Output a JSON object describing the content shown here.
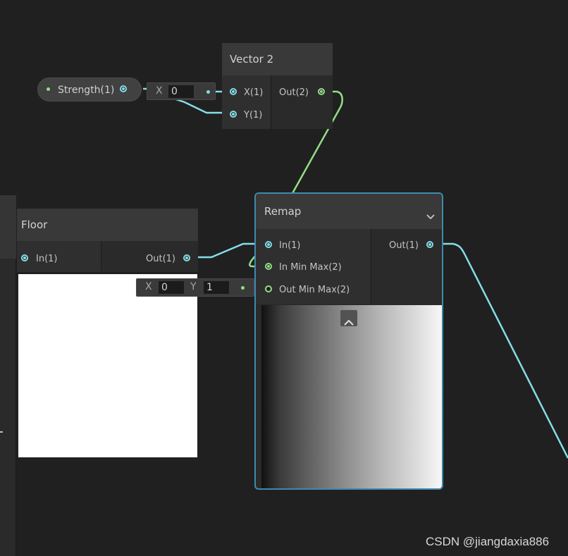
{
  "colors": {
    "canvas": "#202020",
    "node_header": "#393939",
    "node_body": "#2a2a2a",
    "vector1_wire": "#85dde8",
    "vector2_wire": "#93dd86",
    "selection_outline": "#3e8ab0"
  },
  "property_node": {
    "label": "Strength(1)",
    "icon": "property-dot-icon"
  },
  "vector2_node": {
    "title": "Vector 2",
    "inputs": [
      {
        "label": "X(1)"
      },
      {
        "label": "Y(1)"
      }
    ],
    "output": {
      "label": "Out(2)"
    },
    "inline_field": {
      "axis": "X",
      "value": "0"
    }
  },
  "floor_node": {
    "title": "Floor",
    "input": {
      "label": "In(1)"
    },
    "output": {
      "label": "Out(1)"
    }
  },
  "remap_node": {
    "title": "Remap",
    "collapse_icon": "chevron-down-icon",
    "inputs": [
      {
        "label": "In(1)"
      },
      {
        "label": "In Min Max(2)"
      },
      {
        "label": "Out Min Max(2)"
      }
    ],
    "output": {
      "label": "Out(1)"
    },
    "out_min_max_field": {
      "x_label": "X",
      "x_value": "0",
      "y_label": "Y",
      "y_value": "1"
    },
    "preview_toggle_icon": "chevron-up-icon"
  },
  "watermark": "CSDN @jiangdaxia886"
}
